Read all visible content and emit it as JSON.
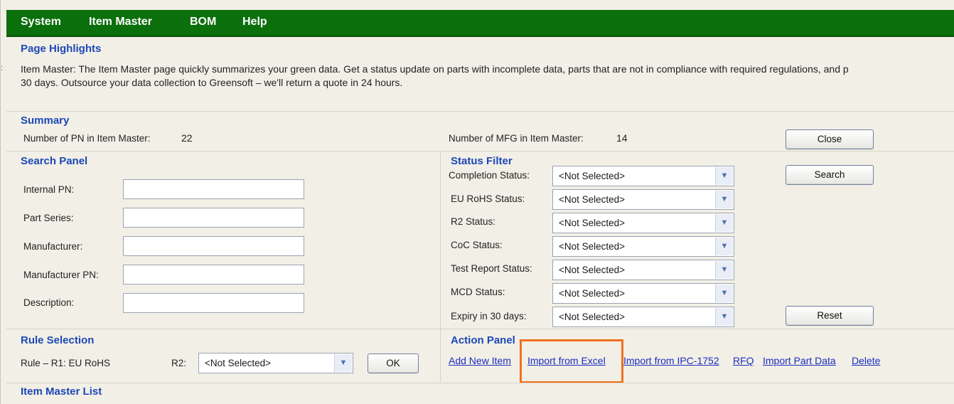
{
  "menu": [
    "System",
    "Item Master",
    "BOM",
    "Help"
  ],
  "highlights": {
    "title": "Page Highlights",
    "text": "Item Master: The Item Master page quickly summarizes your green data. Get a status update on parts with incomplete data, parts that are not in compliance with required regulations, and p\n30 days. Outsource your data collection to Greensoft – we'll return a quote in 24 hours."
  },
  "summary": {
    "title": "Summary",
    "pn_label": "Number of PN in Item Master:",
    "pn_value": "22",
    "mfg_label": "Number of MFG in Item Master:",
    "mfg_value": "14",
    "close_label": "Close"
  },
  "search_panel": {
    "title": "Search Panel",
    "fields": [
      {
        "label": "Internal PN:",
        "value": ""
      },
      {
        "label": "Part Series:",
        "value": ""
      },
      {
        "label": "Manufacturer:",
        "value": ""
      },
      {
        "label": "Manufacturer PN:",
        "value": ""
      },
      {
        "label": "Description:",
        "value": ""
      }
    ]
  },
  "status_filter": {
    "title": "Status Filter",
    "filters": [
      {
        "label": "Completion Status:",
        "value": "<Not Selected>"
      },
      {
        "label": "EU RoHS Status:",
        "value": "<Not Selected>"
      },
      {
        "label": "R2 Status:",
        "value": "<Not Selected>"
      },
      {
        "label": "CoC Status:",
        "value": "<Not Selected>"
      },
      {
        "label": "Test Report Status:",
        "value": "<Not Selected>"
      },
      {
        "label": "MCD Status:",
        "value": "<Not Selected>"
      },
      {
        "label": "Expiry in 30 days:",
        "value": "<Not Selected>"
      }
    ],
    "search_label": "Search",
    "reset_label": "Reset"
  },
  "rule_selection": {
    "title": "Rule Selection",
    "rule_text": "Rule  –  R1: EU RoHS",
    "r2_label": "R2:",
    "r2_value": "<Not Selected>",
    "ok_label": "OK"
  },
  "action_panel": {
    "title": "Action Panel",
    "links": [
      "Add New Item",
      "Import from Excel",
      "Import from IPC-1752",
      "RFQ",
      "Import Part Data",
      "Delete"
    ]
  },
  "list": {
    "title": "Item Master  List"
  },
  "colors": {
    "menubar": "#0b6f0b",
    "section_title": "#1c48b8",
    "link": "#1a2ec1",
    "highlight": "#f07020"
  }
}
